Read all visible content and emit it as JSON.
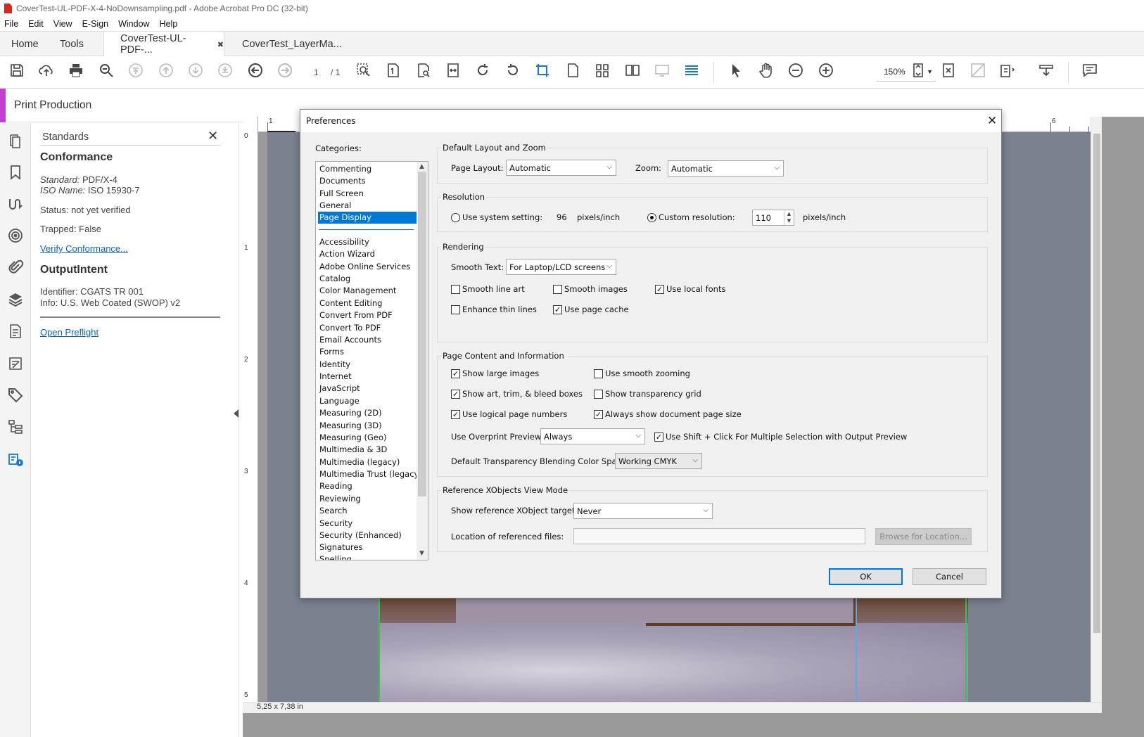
{
  "window": {
    "title": "CoverTest-UL-PDF-X-4-NoDownsampling.pdf - Adobe Acrobat Pro DC (32-bit)"
  },
  "menu": [
    "File",
    "Edit",
    "View",
    "E-Sign",
    "Window",
    "Help"
  ],
  "tabs": {
    "home": "Home",
    "tools": "Tools",
    "doc1": "CoverTest-UL-PDF-...",
    "doc1_close": "✖",
    "doc2": "CoverTest_LayerMa..."
  },
  "toolbar": {
    "page_current": "1",
    "page_total": "/ 1",
    "zoom": "150%"
  },
  "print_production": {
    "title": "Print Production"
  },
  "standards_panel": {
    "title": "Standards",
    "close": "✕",
    "conformance_heading": "Conformance",
    "standard_label": "Standard:",
    "standard_value": "PDF/X-4",
    "iso_label": "ISO Name:",
    "iso_value": "ISO 15930-7",
    "status": "Status: not yet verified",
    "trapped": "Trapped: False",
    "verify_link": "Verify Conformance...",
    "outputintent_heading": "OutputIntent",
    "identifier": "Identifier: CGATS TR 001",
    "info": "Info: U.S. Web Coated (SWOP) v2",
    "preflight_link": "Open Preflight"
  },
  "rulers": {
    "top": [
      "1",
      "6"
    ],
    "left": [
      "0",
      "1",
      "2",
      "3",
      "4",
      "5"
    ]
  },
  "status": {
    "page_size": "5,25 x 7,38 in"
  },
  "dialog": {
    "title": "Preferences",
    "close": "✕",
    "categories_label": "Categories:",
    "categories_top": [
      "Commenting",
      "Documents",
      "Full Screen",
      "General",
      "Page Display"
    ],
    "categories_bottom": [
      "Accessibility",
      "Action Wizard",
      "Adobe Online Services",
      "Catalog",
      "Color Management",
      "Content Editing",
      "Convert From PDF",
      "Convert To PDF",
      "Email Accounts",
      "Forms",
      "Identity",
      "Internet",
      "JavaScript",
      "Language",
      "Measuring (2D)",
      "Measuring (3D)",
      "Measuring (Geo)",
      "Multimedia & 3D",
      "Multimedia (legacy)",
      "Multimedia Trust (legacy)",
      "Reading",
      "Reviewing",
      "Search",
      "Security",
      "Security (Enhanced)",
      "Signatures",
      "Spelling"
    ],
    "selected_category": "Page Display",
    "layout_group": {
      "title": "Default Layout and Zoom",
      "page_layout_label": "Page Layout:",
      "page_layout_value": "Automatic",
      "zoom_label": "Zoom:",
      "zoom_value": "Automatic"
    },
    "resolution_group": {
      "title": "Resolution",
      "system_label": "Use system setting:",
      "system_value": "96",
      "system_unit": "pixels/inch",
      "custom_label": "Custom resolution:",
      "custom_value": "110",
      "custom_unit": "pixels/inch",
      "selected": "custom"
    },
    "rendering_group": {
      "title": "Rendering",
      "smooth_text_label": "Smooth Text:",
      "smooth_text_value": "For Laptop/LCD screens",
      "smooth_line_art": {
        "label": "Smooth line art",
        "checked": false
      },
      "smooth_images": {
        "label": "Smooth images",
        "checked": false
      },
      "use_local_fonts": {
        "label": "Use local fonts",
        "checked": true
      },
      "enhance_thin_lines": {
        "label": "Enhance thin lines",
        "checked": false
      },
      "use_page_cache": {
        "label": "Use page cache",
        "checked": true
      }
    },
    "content_group": {
      "title": "Page Content and Information",
      "show_large_images": {
        "label": "Show large images",
        "checked": true
      },
      "use_smooth_zooming": {
        "label": "Use smooth zooming",
        "checked": false
      },
      "show_boxes": {
        "label": "Show art, trim, & bleed boxes",
        "checked": true
      },
      "show_transparency_grid": {
        "label": "Show transparency grid",
        "checked": false
      },
      "logical_page_numbers": {
        "label": "Use logical page numbers",
        "checked": true
      },
      "always_show_page_size": {
        "label": "Always show document page size",
        "checked": true
      },
      "overprint_label": "Use Overprint Preview:",
      "overprint_value": "Always",
      "shift_click": {
        "label": "Use Shift + Click For Multiple Selection with Output Preview",
        "checked": true
      },
      "blend_label": "Default Transparency Blending Color Space:",
      "blend_value": "Working CMYK"
    },
    "xobjects_group": {
      "title": "Reference XObjects View Mode",
      "targets_label": "Show reference XObject targets:",
      "targets_value": "Never",
      "location_label": "Location of referenced files:",
      "location_value": "",
      "browse_button": "Browse for Location..."
    },
    "ok_button": "OK",
    "cancel_button": "Cancel"
  }
}
